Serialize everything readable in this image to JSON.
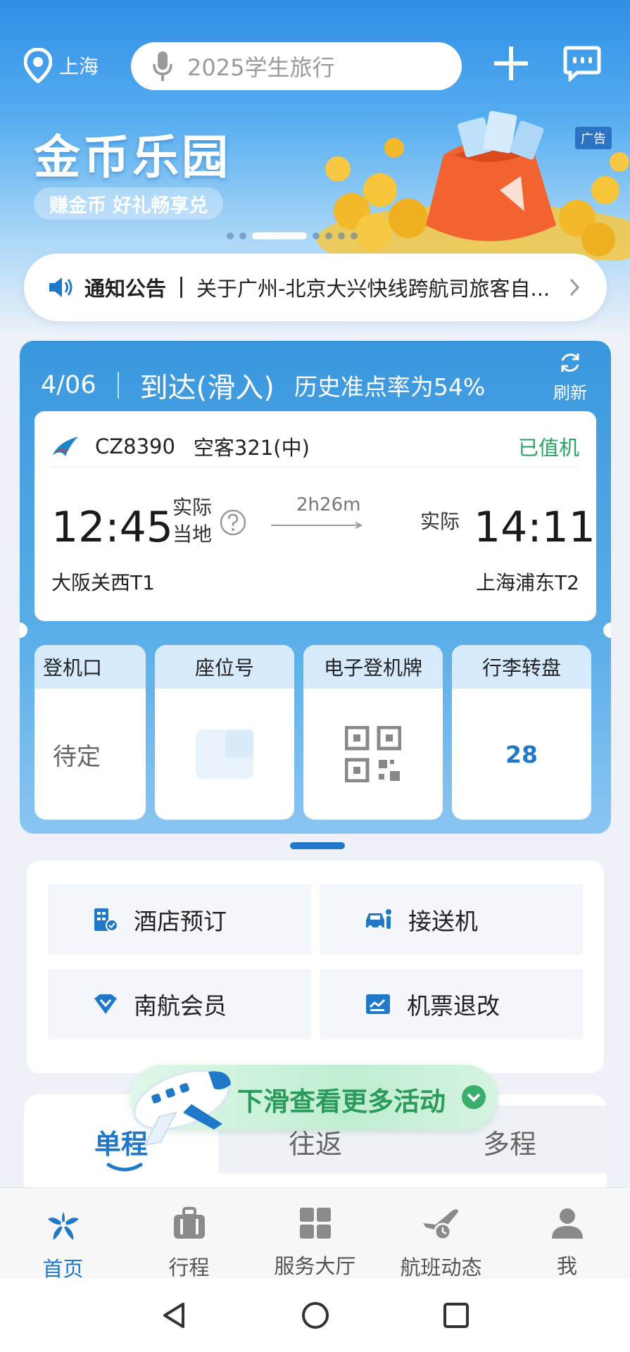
{
  "header": {
    "location": "上海",
    "search_placeholder": "2025学生旅行"
  },
  "banner": {
    "title": "金币乐园",
    "subtitle": "赚金币 好礼畅享兑",
    "ad_label": "广告",
    "page_index": 3,
    "page_count": 8
  },
  "notice": {
    "title": "通知公告",
    "text": "关于广州-北京大兴快线跨航司旅客自..."
  },
  "flight": {
    "date": "4/06",
    "status": "到达(滑入)",
    "ontime": "历史准点率为54%",
    "refresh_label": "刷新",
    "flight_no": "CZ8390",
    "aircraft": "空客321(中)",
    "checkin_status": "已值机",
    "dep_time": "12:45",
    "dep_label_1": "实际",
    "dep_label_2": "当地",
    "duration": "2h26m",
    "arr_label": "实际",
    "arr_time": "14:11",
    "dep_airport": "大阪关西T1",
    "arr_airport": "上海浦东T2",
    "accent": "#1f78c8",
    "checkin_color": "#2aa566"
  },
  "info": {
    "gate_label": "登机口",
    "gate_value": "待定",
    "seat_label": "座位号",
    "boarding_label": "电子登机牌",
    "baggage_label": "行李转盘",
    "baggage_value": "28"
  },
  "services": {
    "hotel": "酒店预订",
    "transfer": "接送机",
    "member": "南航会员",
    "ticket_change": "机票退改"
  },
  "promo": {
    "text": "下滑查看更多活动"
  },
  "tabs": {
    "oneway": "单程",
    "roundtrip": "往返",
    "multi": "多程"
  },
  "nav": {
    "home": "首页",
    "trips": "行程",
    "service_hall": "服务大厅",
    "flight_status": "航班动态",
    "me": "我"
  }
}
